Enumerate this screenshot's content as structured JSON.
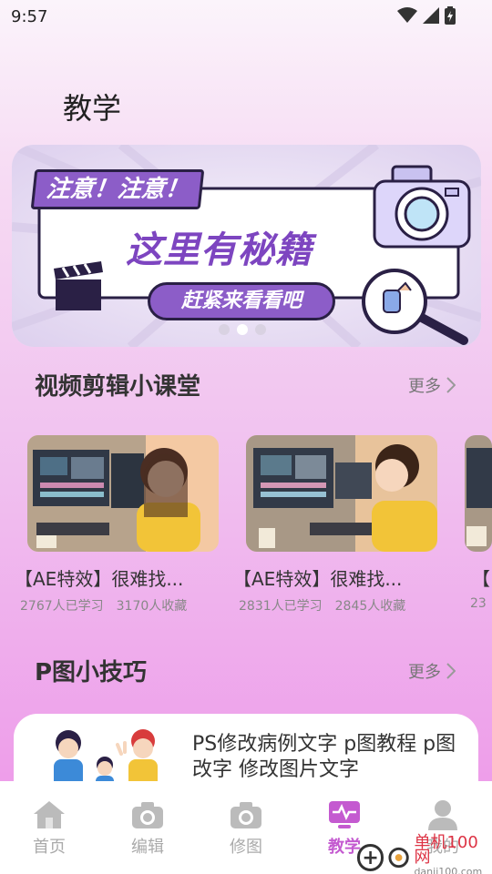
{
  "status_bar": {
    "time": "9:57"
  },
  "page_title": "教学",
  "banner": {
    "tag": "注意！注意！",
    "headline": "这里有秘籍",
    "cta": "赶紧来看看吧",
    "dots": 3,
    "active_dot": 2
  },
  "sections": {
    "video": {
      "title": "视频剪辑小课堂",
      "more": "更多",
      "courses": [
        {
          "title": "【AE特效】很难找...",
          "learners": "2767人已学习",
          "favorites": "3170人收藏"
        },
        {
          "title": "【AE特效】很难找...",
          "learners": "2831人已学习",
          "favorites": "2845人收藏"
        },
        {
          "title": "【",
          "learners": "23",
          "favorites": ""
        }
      ]
    },
    "photo": {
      "title": "P图小技巧",
      "more": "更多",
      "tip": {
        "title": "PS修改病例文字 p图教程 p图改字 修改图片文字"
      }
    }
  },
  "bottom_nav": [
    {
      "label": "首页",
      "icon": "home-icon",
      "active": false
    },
    {
      "label": "编辑",
      "icon": "camera-icon",
      "active": false
    },
    {
      "label": "修图",
      "icon": "camera-icon",
      "active": false
    },
    {
      "label": "教学",
      "icon": "pulse-tv-icon",
      "active": true
    },
    {
      "label": "我的",
      "icon": "user-icon",
      "active": false
    }
  ],
  "watermark": {
    "text": "单机100网",
    "url": "danji100.com"
  },
  "colors": {
    "accent": "#c45ad0",
    "banner_purple": "#8c5dc8"
  }
}
